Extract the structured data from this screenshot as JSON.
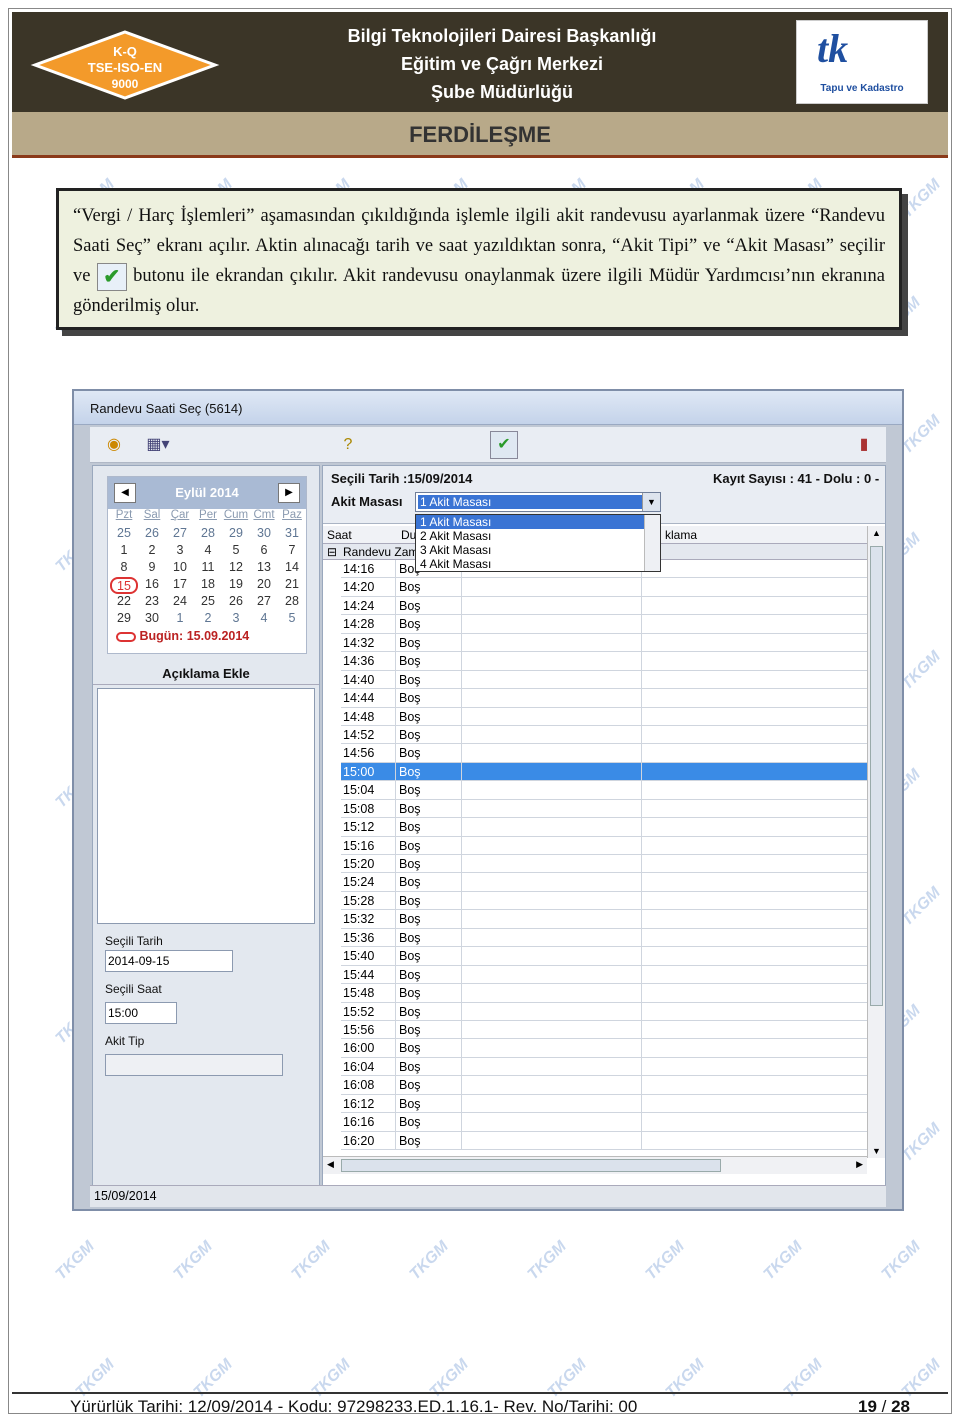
{
  "header": {
    "org_line1": "Bilgi Teknolojileri Dairesi Başkanlığı",
    "org_line2": "Eğitim ve Çağrı Merkezi",
    "org_line3": "Şube Müdürlüğü",
    "left_logo": {
      "l1": "K-Q",
      "l2": "TSE-ISO-EN",
      "l3": "9000"
    },
    "right_logo": {
      "mark": "tk",
      "caption": "Tapu ve Kadastro"
    },
    "section_title": "FERDİLEŞME"
  },
  "note": {
    "part1": "“Vergi / Harç İşlemleri” aşamasından çıkıldığında işlemle ilgili akit randevusu ayarlanmak üzere “Randevu Saati Seç” ekranı açılır.  Aktin alınacağı tarih ve saat yazıldıktan sonra, “Akit Tipi” ve “Akit Masası” seçilir ve",
    "part2": "butonu ile ekrandan çıkılır. Akit randevusu onaylanmak üzere ilgili Müdür Yardımcısı’nın ekranına gönderilmiş olur."
  },
  "window": {
    "title": "Randevu Saati Seç (5614)",
    "calendar": {
      "month": "Eylül 2014",
      "day_names": [
        "Pzt",
        "Sal",
        "Çar",
        "Per",
        "Cum",
        "Cmt",
        "Paz"
      ],
      "days": [
        "25",
        "26",
        "27",
        "28",
        "29",
        "30",
        "31",
        "1",
        "2",
        "3",
        "4",
        "5",
        "6",
        "7",
        "8",
        "9",
        "10",
        "11",
        "12",
        "13",
        "14",
        "15",
        "16",
        "17",
        "18",
        "19",
        "20",
        "21",
        "22",
        "23",
        "24",
        "25",
        "26",
        "27",
        "28",
        "29",
        "30",
        "1",
        "2",
        "3",
        "4",
        "5"
      ],
      "today_label": "Bugün: 15.09.2014"
    },
    "description_label": "Açıklama Ekle",
    "selected_date_label": "Seçili Tarih",
    "selected_date_value": "2014-09-15",
    "selected_time_label": "Seçili Saat",
    "selected_time_value": "15:00",
    "akit_tip_label": "Akit Tip",
    "selected_date_header": "Seçili Tarih :15/09/2014",
    "record_count": "Kayıt Sayısı : 41 - Dolu : 0 -",
    "akit_masasi_label": "Akit Masası",
    "akit_masasi_value": "1 Akit Masası",
    "dropdown_options": [
      "1 Akit Masası",
      "2 Akit Masası",
      "3 Akit Masası",
      "4 Akit Masası"
    ],
    "col_saat": "Saat",
    "col_durum": "Du",
    "col_aciklama": "klama",
    "group_label": "Randevu Zam",
    "rows": [
      {
        "t": "14:16",
        "s": "Boş"
      },
      {
        "t": "14:20",
        "s": "Boş"
      },
      {
        "t": "14:24",
        "s": "Boş"
      },
      {
        "t": "14:28",
        "s": "Boş"
      },
      {
        "t": "14:32",
        "s": "Boş"
      },
      {
        "t": "14:36",
        "s": "Boş"
      },
      {
        "t": "14:40",
        "s": "Boş"
      },
      {
        "t": "14:44",
        "s": "Boş"
      },
      {
        "t": "14:48",
        "s": "Boş"
      },
      {
        "t": "14:52",
        "s": "Boş"
      },
      {
        "t": "14:56",
        "s": "Boş"
      },
      {
        "t": "15:00",
        "s": "Boş"
      },
      {
        "t": "15:04",
        "s": "Boş"
      },
      {
        "t": "15:08",
        "s": "Boş"
      },
      {
        "t": "15:12",
        "s": "Boş"
      },
      {
        "t": "15:16",
        "s": "Boş"
      },
      {
        "t": "15:20",
        "s": "Boş"
      },
      {
        "t": "15:24",
        "s": "Boş"
      },
      {
        "t": "15:28",
        "s": "Boş"
      },
      {
        "t": "15:32",
        "s": "Boş"
      },
      {
        "t": "15:36",
        "s": "Boş"
      },
      {
        "t": "15:40",
        "s": "Boş"
      },
      {
        "t": "15:44",
        "s": "Boş"
      },
      {
        "t": "15:48",
        "s": "Boş"
      },
      {
        "t": "15:52",
        "s": "Boş"
      },
      {
        "t": "15:56",
        "s": "Boş"
      },
      {
        "t": "16:00",
        "s": "Boş"
      },
      {
        "t": "16:04",
        "s": "Boş"
      },
      {
        "t": "16:08",
        "s": "Boş"
      },
      {
        "t": "16:12",
        "s": "Boş"
      },
      {
        "t": "16:16",
        "s": "Boş"
      },
      {
        "t": "16:20",
        "s": "Boş"
      }
    ],
    "selected_row": "15:00",
    "status_date": "15/09/2014"
  },
  "footer": {
    "left": "Yürürlük Tarihi:  12/09/2014  -  Kodu:  97298233.ED.1.16.1-  Rev. No/Tarihi: 00",
    "page_current": "19",
    "page_sep": " / ",
    "page_total": "28"
  },
  "watermark_text": "TKGM"
}
